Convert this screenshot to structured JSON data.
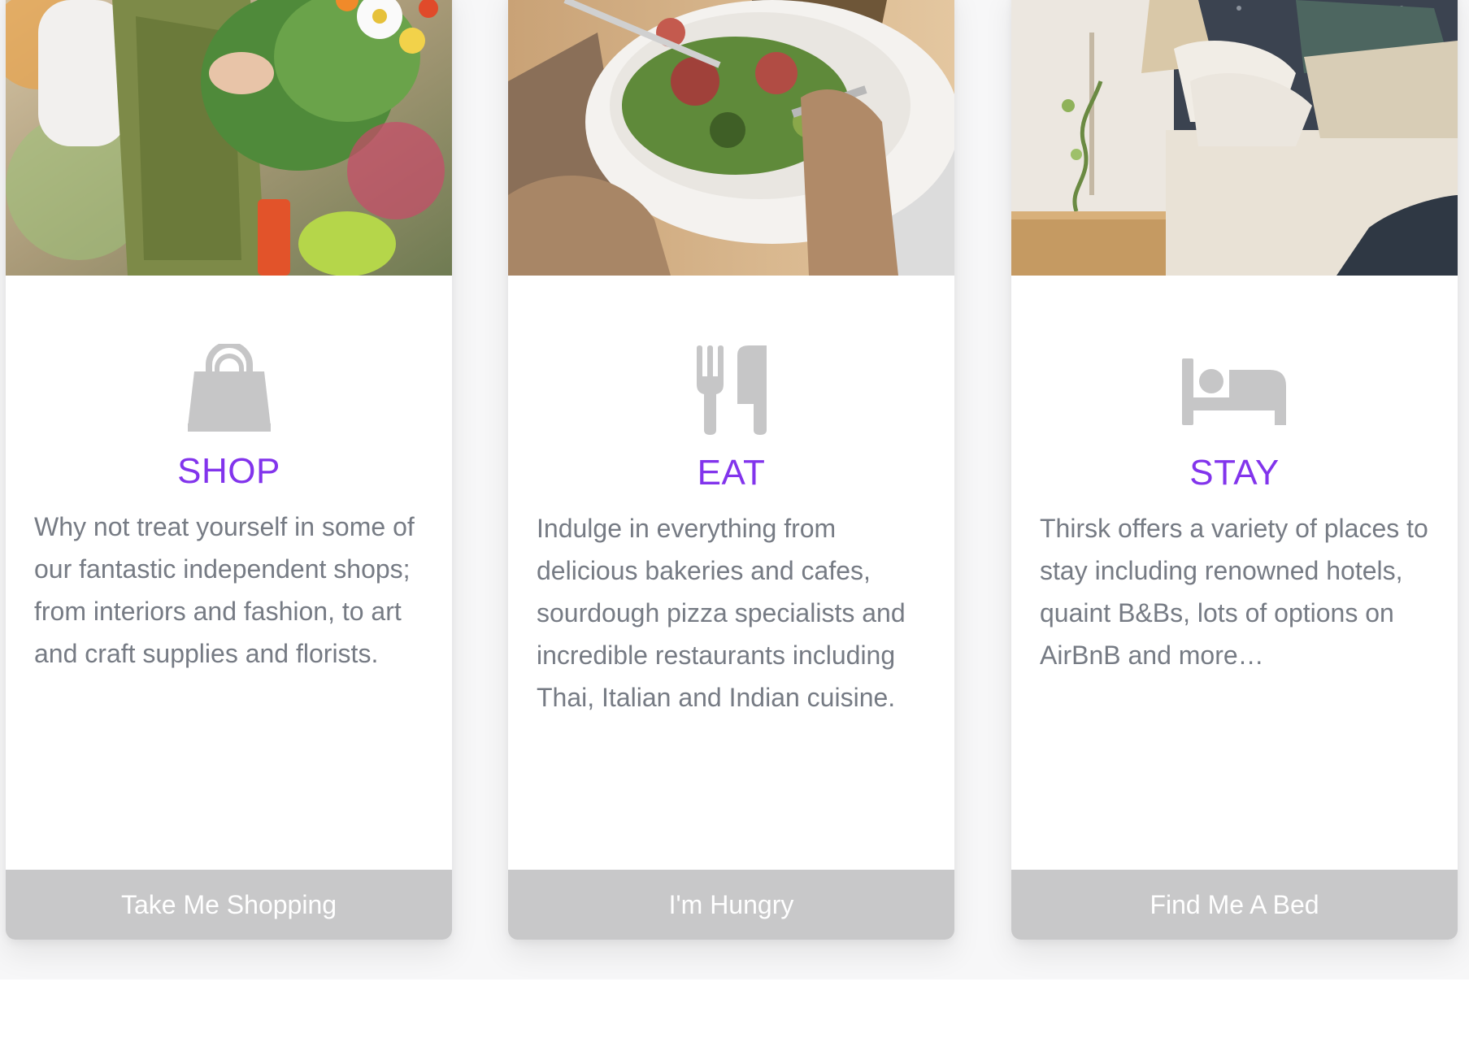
{
  "cards": [
    {
      "icon": "shopping-bag-icon",
      "title": "SHOP",
      "body": "Why not treat yourself in some of our fantastic independent shops; from interiors and fashion, to art and craft supplies and florists.",
      "button": "Take Me Shopping",
      "image": "florist-arranging-bouquet-photo"
    },
    {
      "icon": "fork-knife-icon",
      "title": "EAT",
      "body": "Indulge in everything from delicious bakeries and cafes, sourdough pizza specialists and incredible restaurants including Thai, Italian and Indian cuisine.",
      "button": "I'm Hungry",
      "image": "salad-plate-dining-photo"
    },
    {
      "icon": "bed-icon",
      "title": "STAY",
      "body": "Thirsk offers a variety of places to stay including renowned hotels, quaint B&Bs, lots of options on AirBnB and more…",
      "button": "Find Me A Bed",
      "image": "bedroom-bedside-lamp-photo"
    }
  ],
  "colors": {
    "accent": "#8234ec",
    "body_text": "#767b84",
    "icon": "#c6c6c7",
    "button_bg": "#c8c8c9",
    "button_text": "#ffffff"
  }
}
